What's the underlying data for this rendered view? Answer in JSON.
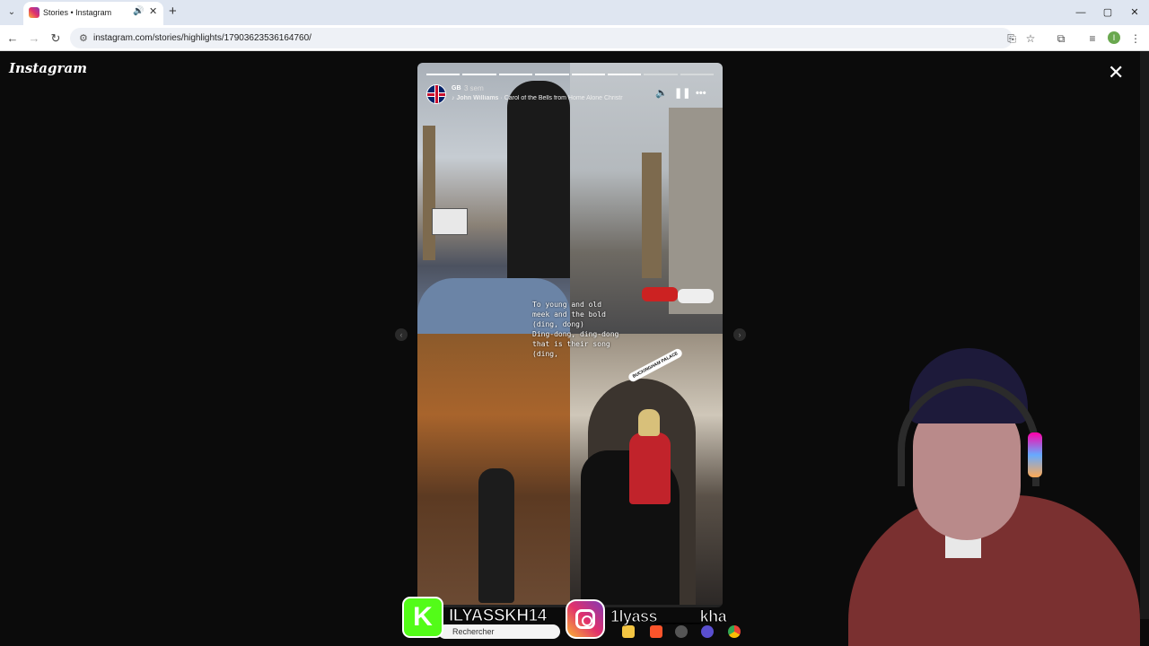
{
  "browser": {
    "tab_title": "Stories • Instagram",
    "new_tab": "+",
    "url": "instagram.com/stories/highlights/17903623536164760/",
    "window_controls": [
      "—",
      "▢",
      "✕"
    ]
  },
  "instagram": {
    "logo": "Instagram",
    "close_icon": "✕",
    "story": {
      "username": "GB",
      "time": "3 sem",
      "music_artist": "John Williams",
      "music_title": " · Carol of the Bells from Home Alone Christr",
      "segments_total": 8,
      "segments_done": 6,
      "lyrics": "To young and old\nmeek and the bold\n(ding, dong)\nDing-dong, ding-dong\nthat is their song\n(ding,",
      "location_tag": "BUCKINGHAM PALACE"
    }
  },
  "overlay": {
    "kick_letter": "K",
    "kick_name": "ILYASSKH14",
    "instagram_name": "1lyass_____kha"
  },
  "taskbar": {
    "search_placeholder": "Rechercher"
  },
  "colors": {
    "kick_green": "#53fc18",
    "viewer_bg": "#0b0b0b"
  }
}
